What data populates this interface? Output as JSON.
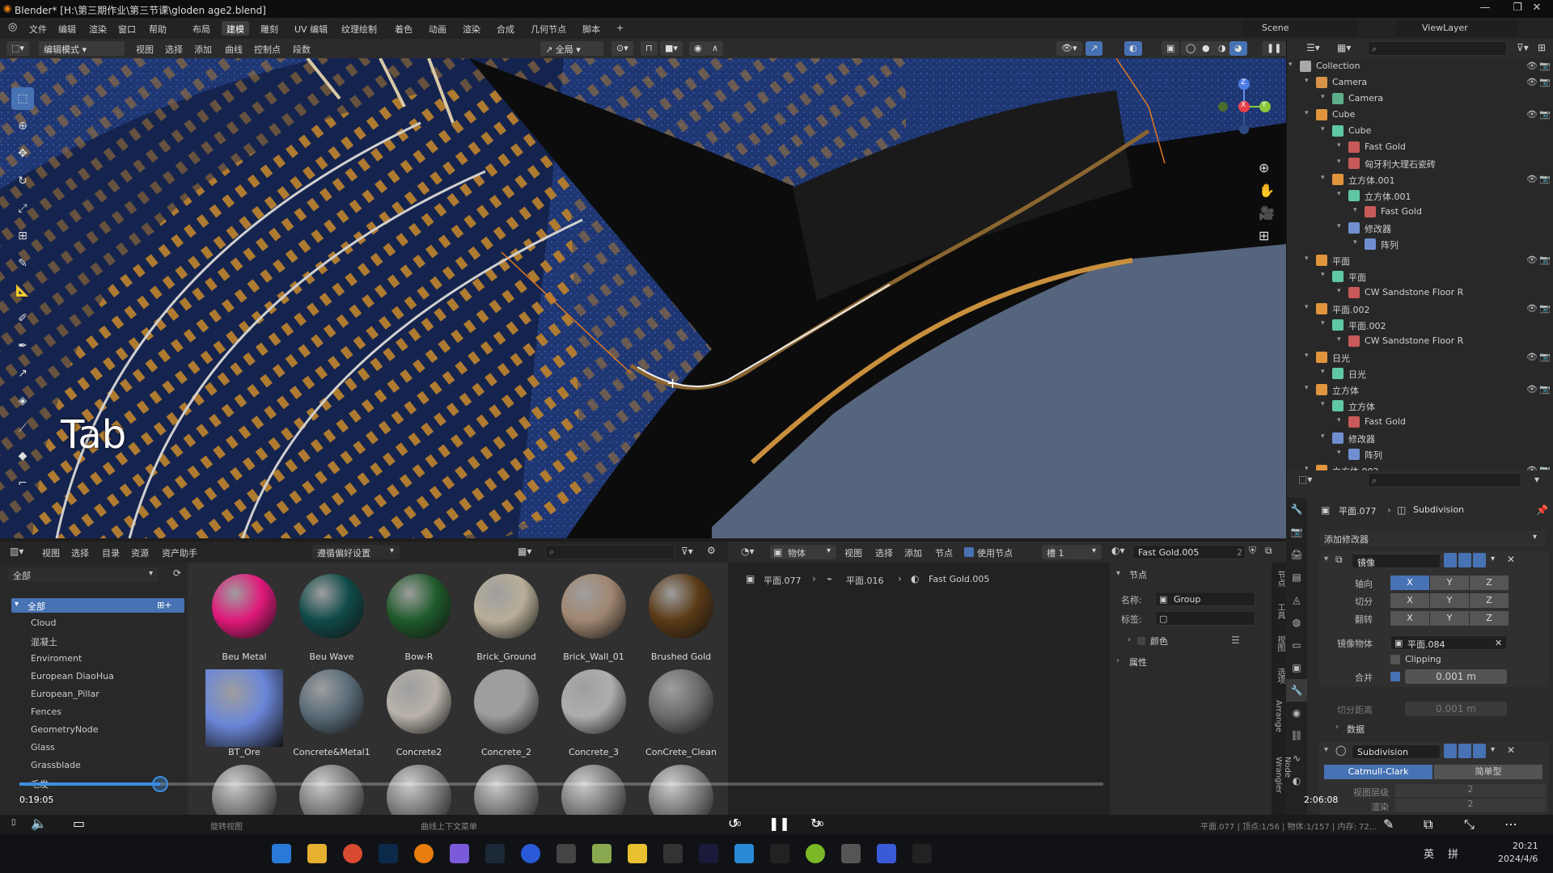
{
  "window": {
    "title": "Blender* [H:\\第三期作业\\第三节课\\gloden age2.blend]",
    "minimize": "—",
    "maximize": "❐",
    "close": "✕"
  },
  "menu": {
    "items": [
      "文件",
      "编辑",
      "渲染",
      "窗口",
      "帮助"
    ],
    "workspaces": [
      "布局",
      "建模",
      "雕刻",
      "UV 编辑",
      "纹理绘制",
      "着色",
      "动画",
      "渲染",
      "合成",
      "几何节点",
      "脚本"
    ],
    "active_workspace": "建模",
    "add_workspace": "+",
    "scene": "Scene",
    "viewlayer": "ViewLayer"
  },
  "header3d": {
    "mode": "编辑模式",
    "menus": [
      "视图",
      "选择",
      "添加",
      "曲线",
      "控制点",
      "段数"
    ],
    "transform_orientation": "全局"
  },
  "viewport": {
    "overlay_text": "Tab",
    "gizmo": {
      "x": "X",
      "y": "Y",
      "z": "Z"
    }
  },
  "outliner": {
    "rows": [
      {
        "label": "Collection",
        "depth": 0,
        "icon": "collection-icon",
        "color": "#a8a8a8",
        "vis": true
      },
      {
        "label": "Camera",
        "depth": 1,
        "icon": "camera-icon",
        "color": "#d8944a",
        "vis": true
      },
      {
        "label": "Camera",
        "depth": 2,
        "icon": "camera-data-icon",
        "color": "#5fae8a",
        "vis": false
      },
      {
        "label": "Cube",
        "depth": 1,
        "icon": "mesh-object-icon",
        "color": "#e0943c",
        "vis": true
      },
      {
        "label": "Cube",
        "depth": 2,
        "icon": "mesh-data-icon",
        "color": "#5fc7a6",
        "vis": false
      },
      {
        "label": "Fast Gold",
        "depth": 3,
        "icon": "material-icon",
        "color": "#c95a5a",
        "vis": false
      },
      {
        "label": "匈牙利大理石瓷砖",
        "depth": 3,
        "icon": "material-icon",
        "color": "#c95a5a",
        "vis": false
      },
      {
        "label": "立方体.001",
        "depth": 2,
        "icon": "mesh-object-icon",
        "color": "#e0943c",
        "vis": true
      },
      {
        "label": "立方体.001",
        "depth": 3,
        "icon": "mesh-data-icon",
        "color": "#5fc7a6",
        "vis": false
      },
      {
        "label": "Fast Gold",
        "depth": 4,
        "icon": "material-icon",
        "color": "#c95a5a",
        "vis": false
      },
      {
        "label": "修改器",
        "depth": 3,
        "icon": "wrench-icon",
        "color": "#6f8fd0",
        "vis": false
      },
      {
        "label": "阵列",
        "depth": 4,
        "icon": "array-modifier-icon",
        "color": "#6f8fd0",
        "vis": false
      },
      {
        "label": "平面",
        "depth": 1,
        "icon": "mesh-object-icon",
        "color": "#e0943c",
        "vis": true
      },
      {
        "label": "平面",
        "depth": 2,
        "icon": "mesh-data-icon",
        "color": "#5fc7a6",
        "vis": false
      },
      {
        "label": "CW Sandstone Floor R",
        "depth": 3,
        "icon": "material-icon",
        "color": "#c95a5a",
        "vis": false
      },
      {
        "label": "平面.002",
        "depth": 1,
        "icon": "mesh-object-icon",
        "color": "#e0943c",
        "vis": true
      },
      {
        "label": "平面.002",
        "depth": 2,
        "icon": "mesh-data-icon",
        "color": "#5fc7a6",
        "vis": false
      },
      {
        "label": "CW Sandstone Floor R",
        "depth": 3,
        "icon": "material-icon",
        "color": "#c95a5a",
        "vis": false
      },
      {
        "label": "日光",
        "depth": 1,
        "icon": "light-icon",
        "color": "#e0943c",
        "vis": true
      },
      {
        "label": "日光",
        "depth": 2,
        "icon": "light-data-icon",
        "color": "#5fc7a6",
        "vis": false
      },
      {
        "label": "立方体",
        "depth": 1,
        "icon": "mesh-object-icon",
        "color": "#e0943c",
        "vis": true
      },
      {
        "label": "立方体",
        "depth": 2,
        "icon": "mesh-data-icon",
        "color": "#5fc7a6",
        "vis": false
      },
      {
        "label": "Fast Gold",
        "depth": 3,
        "icon": "material-icon",
        "color": "#c95a5a",
        "vis": false
      },
      {
        "label": "修改器",
        "depth": 2,
        "icon": "wrench-icon",
        "color": "#6f8fd0",
        "vis": false
      },
      {
        "label": "阵列",
        "depth": 3,
        "icon": "array-modifier-icon",
        "color": "#6f8fd0",
        "vis": false
      },
      {
        "label": "立方体.002",
        "depth": 1,
        "icon": "mesh-object-icon",
        "color": "#e0943c",
        "vis": true
      }
    ]
  },
  "properties": {
    "breadcrumb_object": "平面.077",
    "breadcrumb_modifier": "Subdivision",
    "add_modifier": "添加修改器",
    "mirror": {
      "name": "镜像",
      "axis_label": "轴向",
      "bisect_label": "切分",
      "flip_label": "翻转",
      "x": "X",
      "y": "Y",
      "z": "Z",
      "mirror_object_label": "镜像物体",
      "mirror_object": "平面.084",
      "clipping": "Clipping",
      "merge_label": "合并",
      "merge_value": "0.001 m",
      "bisect_dist_label": "切分距离",
      "bisect_dist_value": "0.001 m",
      "data": "数据"
    },
    "subdivision": {
      "name": "Subdivision",
      "catmull": "Catmull-Clark",
      "simple": "简单型",
      "levels_label": "视图层级",
      "levels_value": "2",
      "render_label": "渲染",
      "render_value": "2"
    }
  },
  "asset_browser": {
    "menus": [
      "视图",
      "选择",
      "目录",
      "资源",
      "资产助手"
    ],
    "library": "遵循偏好设置",
    "filter_all": "全部",
    "categories": [
      "全部",
      "Cloud",
      "混凝土",
      "Enviroment",
      "European DiaoHua",
      "European_Pillar",
      "Fences",
      "GeometryNode",
      "Glass",
      "Grassblade",
      "毛发"
    ],
    "assets": [
      {
        "name": "Beu Metal",
        "color": "#e0187a"
      },
      {
        "name": "Beu Wave",
        "color": "#0f4a48"
      },
      {
        "name": "Bow-R",
        "color": "#1f5a2a"
      },
      {
        "name": "Brick_Ground",
        "color": "#b8ae98"
      },
      {
        "name": "Brick_Wall_01",
        "color": "#a08670"
      },
      {
        "name": "Brushed Gold",
        "color": "#5a3a16"
      },
      {
        "name": "BT_Ore",
        "color": "#6a86d8"
      },
      {
        "name": "Concrete&Metal1",
        "color": "#5a6c78"
      },
      {
        "name": "Concrete2",
        "color": "#b8b2aa"
      },
      {
        "name": "Concrete_2",
        "color": "#9e9e9e"
      },
      {
        "name": "Concrete_3",
        "color": "#aeaeae"
      },
      {
        "name": "ConCrete_Clean",
        "color": "#6c6c6c"
      }
    ]
  },
  "node_editor": {
    "type": "物体",
    "menus": [
      "视图",
      "选择",
      "添加",
      "节点"
    ],
    "use_nodes": "使用节点",
    "slot": "槽 1",
    "material": "Fast Gold.005",
    "users": "2",
    "breadcrumb": [
      "平面.077",
      "平面.016",
      "Fast Gold.005"
    ],
    "side_node": "节点",
    "name_label": "名称:",
    "name_value": "Group",
    "label_label": "标签:",
    "color": "颜色",
    "properties": "属性",
    "tabs": [
      "节点",
      "工具",
      "视图",
      "选项",
      "Arrange",
      "Node Wrangler"
    ]
  },
  "media": {
    "time_elapsed": "0:19:05",
    "time_remaining": "2:06:08",
    "progress": 0.13,
    "skip_back": "10",
    "skip_fwd": "30"
  },
  "statusbar": {
    "left": "旋转视图",
    "middle": "曲线上下文菜单",
    "right": "平面.077 | 顶点:1/56 | 物体:1/157 | 内存: 72..."
  },
  "taskbar": {
    "ime": "英",
    "layout": "拼",
    "time": "20:21",
    "date": "2024/4/6"
  }
}
